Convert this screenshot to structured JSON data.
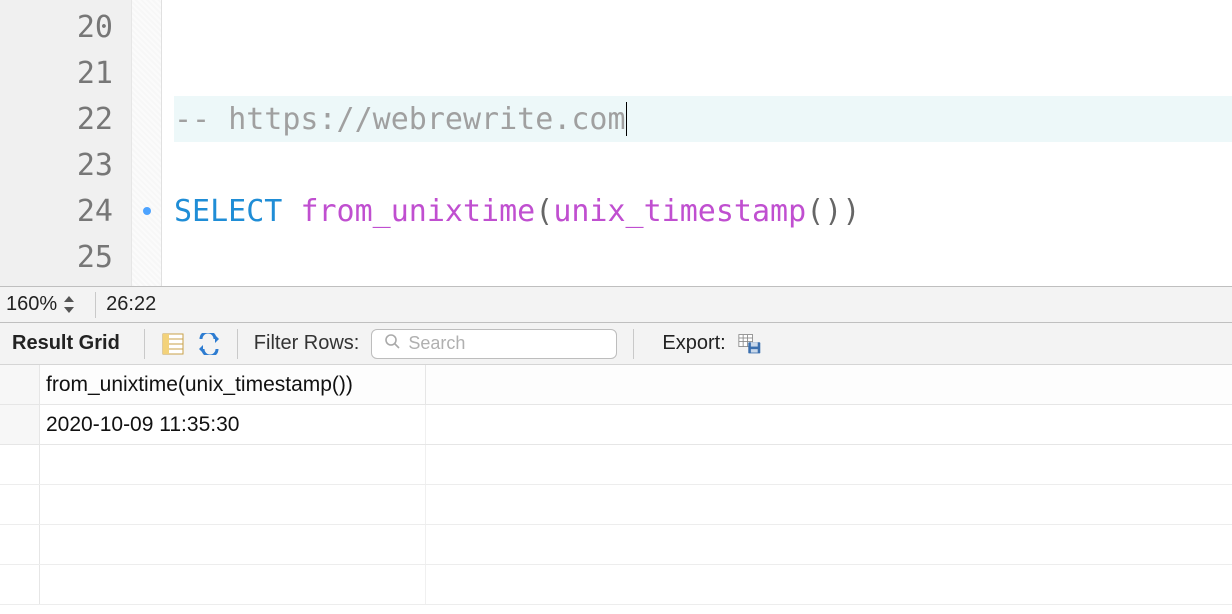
{
  "editor": {
    "line_numbers": [
      "20",
      "21",
      "22",
      "23",
      "24",
      "25"
    ],
    "marker_lines": [
      4
    ],
    "current_line_index": 2,
    "lines": {
      "l22_comment_prefix": "-- ",
      "l22_comment_text": "https://webrewrite.com",
      "l24_keyword": "SELECT ",
      "l24_func1": "from_unixtime",
      "l24_open1": "(",
      "l24_func2": "unix_timestamp",
      "l24_parens2": "()",
      "l24_close1": ")"
    }
  },
  "status": {
    "zoom": "160%",
    "cursor_position": "26:22"
  },
  "result_toolbar": {
    "title": "Result Grid",
    "filter_label": "Filter Rows:",
    "search_placeholder": "Search",
    "export_label": "Export:"
  },
  "grid": {
    "column_header": "from_unixtime(unix_timestamp())",
    "rows": [
      {
        "value": "2020-10-09 11:35:30"
      }
    ]
  }
}
